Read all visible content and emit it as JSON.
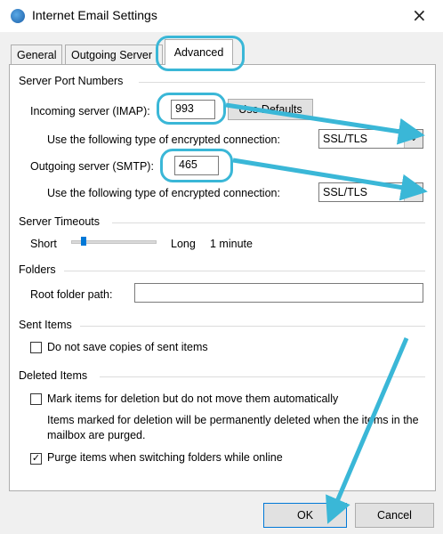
{
  "window": {
    "title": "Internet Email Settings",
    "close_label": "×"
  },
  "tabs": [
    {
      "label": "General"
    },
    {
      "label": "Outgoing Server"
    },
    {
      "label": "Advanced"
    }
  ],
  "server_ports": {
    "heading": "Server Port Numbers",
    "incoming_label": "Incoming server (IMAP):",
    "incoming_value": "993",
    "use_defaults_label": "Use Defaults",
    "incoming_enc_label": "Use the following type of encrypted connection:",
    "incoming_enc_value": "SSL/TLS",
    "outgoing_label": "Outgoing server (SMTP):",
    "outgoing_value": "465",
    "outgoing_enc_label": "Use the following type of encrypted connection:",
    "outgoing_enc_value": "SSL/TLS"
  },
  "timeouts": {
    "heading": "Server Timeouts",
    "short_label": "Short",
    "long_label": "Long",
    "value_label": "1 minute"
  },
  "folders": {
    "heading": "Folders",
    "root_label": "Root folder path:",
    "root_value": ""
  },
  "sent_items": {
    "heading": "Sent Items",
    "no_copies_label": "Do not save copies of sent items",
    "no_copies_checked": false
  },
  "deleted_items": {
    "heading": "Deleted Items",
    "mark_label": "Mark items for deletion but do not move them automatically",
    "mark_checked": false,
    "note": "Items marked for deletion will be permanently deleted when the items in the mailbox are purged.",
    "purge_label": "Purge items when switching folders while online",
    "purge_checked": true
  },
  "footer": {
    "ok_label": "OK",
    "cancel_label": "Cancel"
  },
  "colors": {
    "annotation": "#3ab7d7",
    "accent": "#0078d7"
  },
  "icons": {
    "title": "outlook-globe-icon",
    "close": "close-icon",
    "dropdown": "chevron-down-icon",
    "check": "checkmark-icon"
  }
}
